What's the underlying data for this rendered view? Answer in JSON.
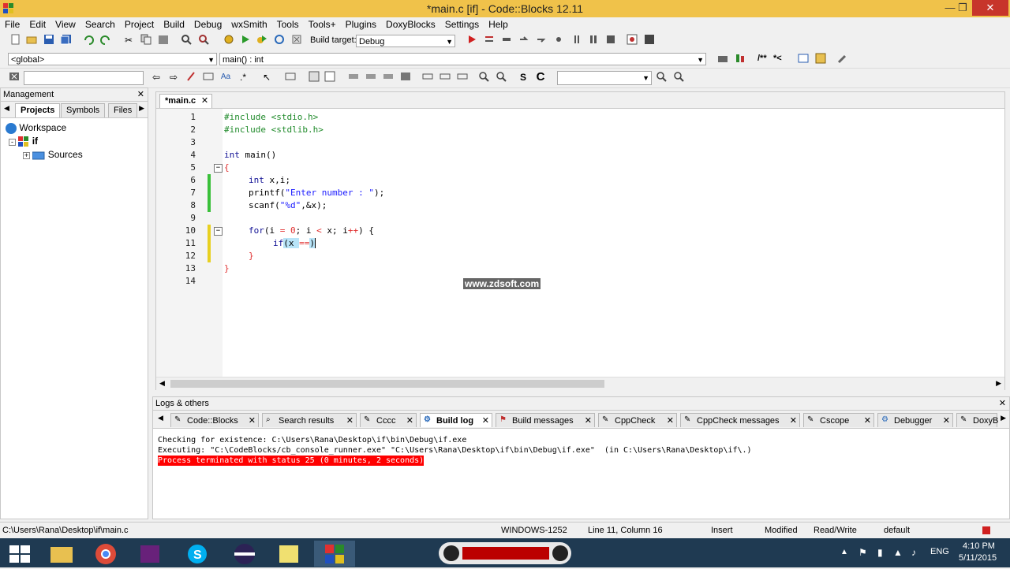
{
  "window": {
    "title": "*main.c [if] - Code::Blocks 12.11",
    "minimize": "—",
    "maximize": "❐",
    "close": "✕"
  },
  "menu": [
    "File",
    "Edit",
    "View",
    "Search",
    "Project",
    "Build",
    "Debug",
    "wxSmith",
    "Tools",
    "Tools+",
    "Plugins",
    "DoxyBlocks",
    "Settings",
    "Help"
  ],
  "toolbar1": {
    "build_target_label": "Build target:",
    "build_target_value": "Debug"
  },
  "toolbar2": {
    "scope": "<global>",
    "function": "main() : int",
    "comment_marker": "/**",
    "lt_marker": "*<"
  },
  "management": {
    "title": "Management",
    "tabs": [
      "Projects",
      "Symbols",
      "Files"
    ],
    "tree": {
      "workspace": "Workspace",
      "project": "if",
      "folder": "Sources"
    }
  },
  "editor": {
    "tab_label": "*main.c",
    "lines": [
      {
        "n": "1"
      },
      {
        "n": "2"
      },
      {
        "n": "3"
      },
      {
        "n": "4"
      },
      {
        "n": "5"
      },
      {
        "n": "6"
      },
      {
        "n": "7"
      },
      {
        "n": "8"
      },
      {
        "n": "9"
      },
      {
        "n": "10"
      },
      {
        "n": "11"
      },
      {
        "n": "12"
      },
      {
        "n": "13"
      },
      {
        "n": "14"
      }
    ],
    "code": {
      "l1": "#include <stdio.h>",
      "l2": "#include <stdlib.h>",
      "l4_kw": "int",
      "l4_rest": " main()",
      "l5": "{",
      "l6_kw": "int",
      "l6_rest": " x,i;",
      "l7_a": "printf(",
      "l7_str": "\"Enter number : \"",
      "l7_b": ");",
      "l8_a": "scanf(",
      "l8_str": "\"%d\"",
      "l8_b": ",&x);",
      "l10_kw": "for",
      "l10_a": "(i ",
      "l10_op1": "=",
      "l10_num": " 0",
      "l10_b": "; i ",
      "l10_op2": "<",
      "l10_c": " x; i",
      "l10_op3": "++",
      "l10_d": ") {",
      "l11_kw": "if",
      "l11_a": "(x ",
      "l11_op": "==",
      "l11_b": ")",
      "l12": "}",
      "l13": "}"
    }
  },
  "watermark": "www.zdsoft.com",
  "logs": {
    "title": "Logs & others",
    "tabs": [
      "Code::Blocks",
      "Search results",
      "Cccc",
      "Build log",
      "Build messages",
      "CppCheck",
      "CppCheck messages",
      "Cscope",
      "Debugger",
      "DoxyB"
    ],
    "lines": [
      "Checking for existence: C:\\Users\\Rana\\Desktop\\if\\bin\\Debug\\if.exe",
      "Executing: \"C:\\CodeBlocks/cb_console_runner.exe\" \"C:\\Users\\Rana\\Desktop\\if\\bin\\Debug\\if.exe\"  (in C:\\Users\\Rana\\Desktop\\if\\.)",
      "Process terminated with status 25 (0 minutes, 2 seconds)"
    ]
  },
  "status": {
    "path": "C:\\Users\\Rana\\Desktop\\if\\main.c",
    "encoding": "WINDOWS-1252",
    "position": "Line 11, Column 16",
    "mode": "Insert",
    "modified": "Modified",
    "access": "Read/Write",
    "lang": "default"
  },
  "taskbar": {
    "lang": "ENG",
    "time": "4:10 PM",
    "date": "5/11/2015"
  },
  "colors": {
    "titlebar": "#f0c24a",
    "taskbar": "#1f3a52",
    "error_bg": "#ff0000",
    "preproc": "#1f8a2a",
    "keyword": "#101094"
  }
}
